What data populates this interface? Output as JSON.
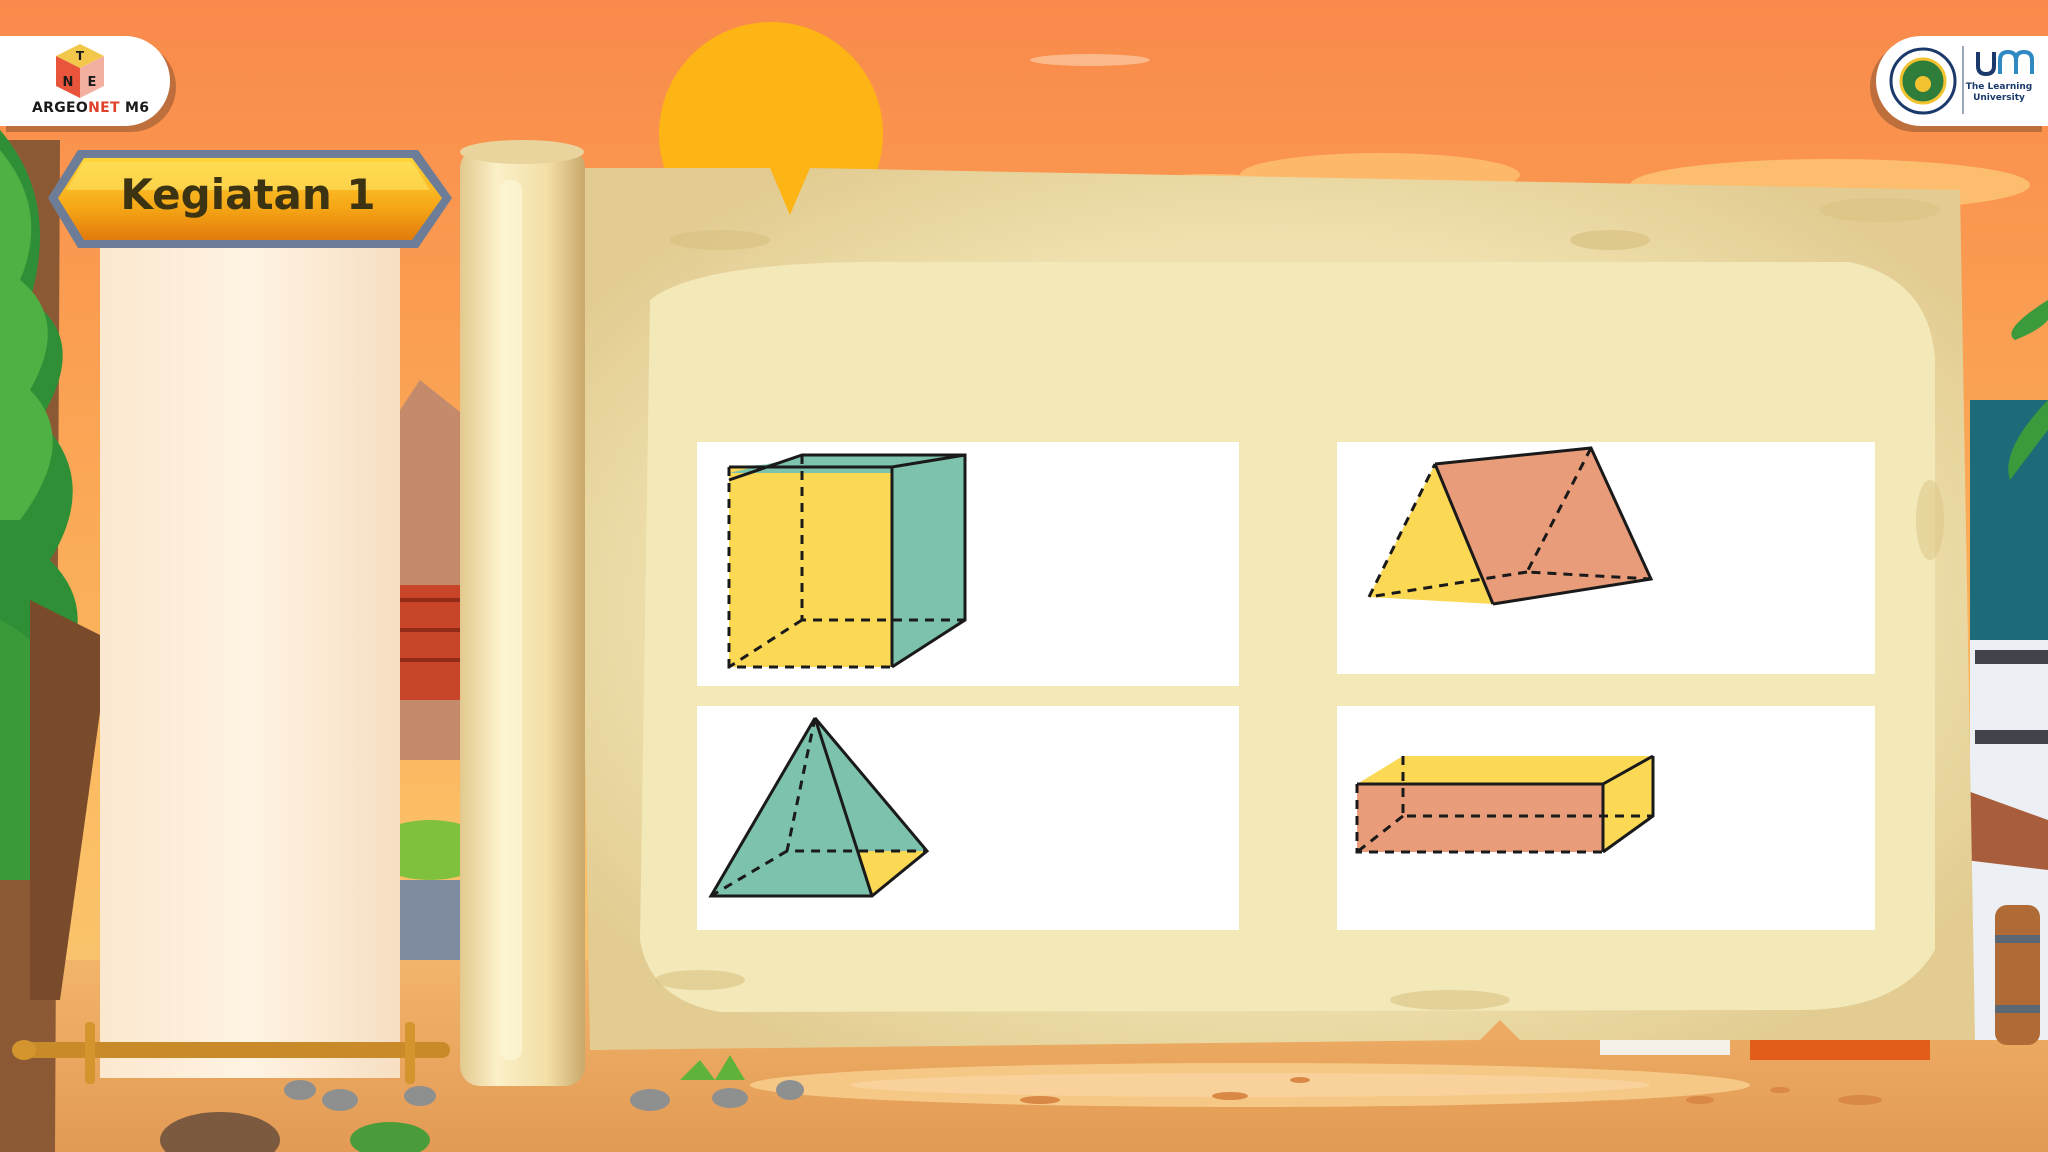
{
  "app": {
    "logo_text_main": "ARGEO",
    "logo_text_accent": "NET",
    "logo_text_suffix": " M6",
    "logo_letters": [
      "T",
      "N",
      "E"
    ],
    "university_tagline_line1": "The Learning",
    "university_tagline_line2": "University"
  },
  "activity": {
    "title": "Kegiatan 1"
  },
  "cards": [
    {
      "shape": "cube-icon"
    },
    {
      "shape": "triangular-prism-icon"
    },
    {
      "shape": "square-pyramid-icon"
    },
    {
      "shape": "rectangular-prism-icon"
    }
  ],
  "colors": {
    "yellow_face": "#fcd955",
    "green_face": "#7cc2ad",
    "salmon_face": "#e99c7a",
    "parchment": "#efe2b0",
    "sky_top": "#f98b4c"
  }
}
